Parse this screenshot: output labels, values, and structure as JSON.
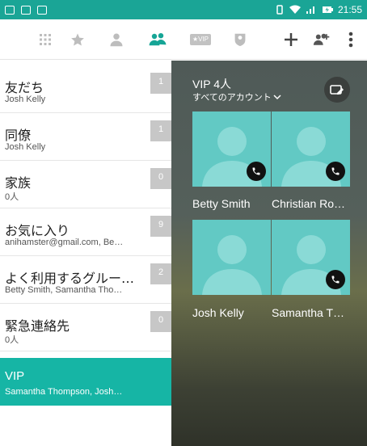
{
  "status_bar": {
    "time": "21:55",
    "left_icons": [
      "notification-icon",
      "screen-icon",
      "photo-icon"
    ],
    "right_icons": [
      "vibrate-icon",
      "wifi-icon",
      "signal-icon",
      "battery-icon"
    ]
  },
  "toolbar": {
    "tabs": [
      {
        "name": "dialpad-tab",
        "icon": "dialpad-icon"
      },
      {
        "name": "favorites-tab",
        "icon": "star-icon"
      },
      {
        "name": "contacts-tab",
        "icon": "person-icon"
      },
      {
        "name": "groups-tab",
        "icon": "group-icon",
        "selected": true
      },
      {
        "name": "vip-tab",
        "icon": "vip-icon",
        "label": "★VIP"
      },
      {
        "name": "blocked-tab",
        "icon": "shield-icon"
      }
    ],
    "actions": [
      {
        "name": "add-button",
        "icon": "plus-icon"
      },
      {
        "name": "add-group-button",
        "icon": "add-group-icon"
      },
      {
        "name": "overflow-menu-button",
        "icon": "more-vert-icon"
      }
    ],
    "accent_color": "#1aa596"
  },
  "groups": [
    {
      "name": "友だち",
      "members": "Josh Kelly",
      "count": "1"
    },
    {
      "name": "同僚",
      "members": "Josh Kelly",
      "count": "1"
    },
    {
      "name": "家族",
      "members": "0人",
      "count": "0"
    },
    {
      "name": "お気に入り",
      "members": "anihamster@gmail.com, Be…",
      "count": "9"
    },
    {
      "name": "よく利用するグルー…",
      "members": "Betty Smith, Samantha Tho…",
      "count": "2"
    },
    {
      "name": "緊急連絡先",
      "members": "0人",
      "count": "0"
    },
    {
      "name": "VIP",
      "members": "Samantha Thompson, Josh…",
      "selected": true
    }
  ],
  "detail": {
    "title": "VIP 4人",
    "account_filter": "すべてのアカウント",
    "edit_icon": "edit-group-icon",
    "contacts": [
      {
        "name": "Betty Smith",
        "has_call": true
      },
      {
        "name": "Christian Ro…",
        "has_call": true
      },
      {
        "name": "Josh Kelly",
        "has_call": false
      },
      {
        "name": "Samantha T…",
        "has_call": true
      }
    ]
  }
}
